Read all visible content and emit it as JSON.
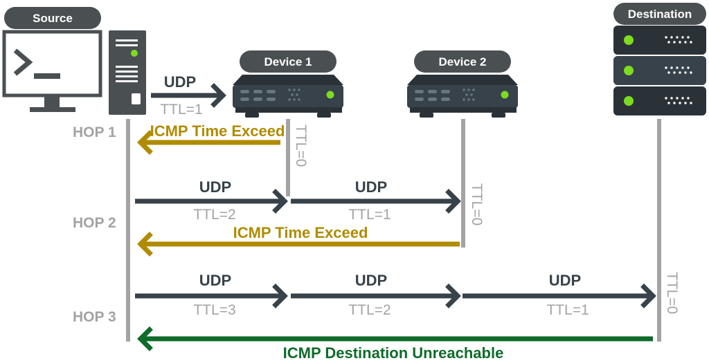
{
  "colors": {
    "dark": "#4a4f52",
    "device": "#37424a",
    "led": "#7ddc1f",
    "lifeline": "#a3a3a3",
    "udp_arrow": "#37424a",
    "icmp_time_exceed": "#b08b00",
    "icmp_unreachable": "#0e6b2a"
  },
  "nodes": {
    "source": {
      "label": "Source"
    },
    "device1": {
      "label": "Device 1"
    },
    "device2": {
      "label": "Device 2"
    },
    "destination": {
      "label": "Destination"
    }
  },
  "hops": [
    {
      "label": "HOP 1"
    },
    {
      "label": "HOP 2"
    },
    {
      "label": "HOP 3"
    }
  ],
  "messages": {
    "hop1_udp": {
      "label": "UDP",
      "ttl": "TTL=1"
    },
    "hop1_ttl_expired_at_device1": "TTL=0",
    "hop1_icmp": "ICMP Time Exceed",
    "hop2_udp_a": {
      "label": "UDP",
      "ttl": "TTL=2"
    },
    "hop2_udp_b": {
      "label": "UDP",
      "ttl": "TTL=1"
    },
    "hop2_ttl_expired_at_device2": "TTL=0",
    "hop2_icmp": "ICMP Time Exceed",
    "hop3_udp_a": {
      "label": "UDP",
      "ttl": "TTL=3"
    },
    "hop3_udp_b": {
      "label": "UDP",
      "ttl": "TTL=2"
    },
    "hop3_udp_c": {
      "label": "UDP",
      "ttl": "TTL=1"
    },
    "hop3_ttl_at_destination": "TTL=0",
    "hop3_icmp": "ICMP Destination Unreachable"
  }
}
